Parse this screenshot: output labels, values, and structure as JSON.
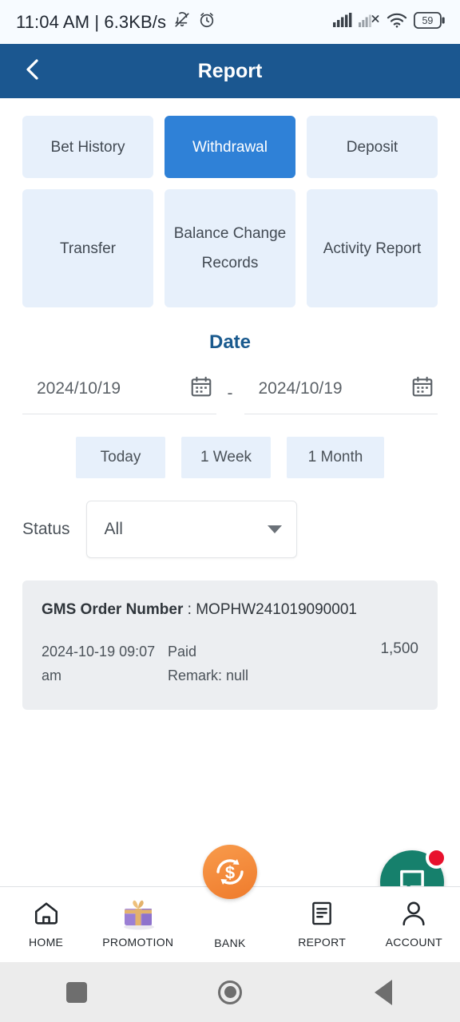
{
  "statusbar": {
    "time_text": "11:04 AM | 6.3KB/s",
    "mute_icon": "bell-muted-icon",
    "alarm_icon": "alarm-clock-icon",
    "signal_icon": "signal-bars-icon",
    "signal_off_icon": "signal-bars-no-service-icon",
    "wifi_icon": "wifi-icon",
    "battery_level": "59"
  },
  "header": {
    "title": "Report",
    "back_icon": "chevron-left-icon"
  },
  "tabs": [
    {
      "label": "Bet History",
      "active": false
    },
    {
      "label": "Withdrawal",
      "active": true
    },
    {
      "label": "Deposit",
      "active": false
    },
    {
      "label": "Transfer",
      "active": false
    },
    {
      "label": "Balance Change Records",
      "active": false
    },
    {
      "label": "Activity Report",
      "active": false
    }
  ],
  "date": {
    "title": "Date",
    "start_value": "2024/10/19",
    "end_value": "2024/10/19",
    "separator": "-",
    "calendar_icon": "calendar-icon",
    "quick_ranges": [
      {
        "label": "Today"
      },
      {
        "label": "1 Week"
      },
      {
        "label": "1 Month"
      }
    ]
  },
  "status_filter": {
    "label": "Status",
    "selected": "All",
    "caret_icon": "chevron-down-icon"
  },
  "records": [
    {
      "order_label": "GMS Order Number",
      "order_separator": " : ",
      "order_number": "MOPHW241019090001",
      "datetime": "2024-10-19 09:07 am",
      "status": "Paid",
      "remark": "Remark: null",
      "amount": "1,500"
    }
  ],
  "chat": {
    "icon": "chat-bubble-icon",
    "badge_icon": "notification-dot-icon"
  },
  "bottom_nav": [
    {
      "label": "HOME",
      "icon": "home-icon"
    },
    {
      "label": "PROMOTION",
      "icon": "gift-box-icon"
    },
    {
      "label": "BANK",
      "icon": "bank-dollar-refresh-icon"
    },
    {
      "label": "REPORT",
      "icon": "document-icon"
    },
    {
      "label": "ACCOUNT",
      "icon": "person-icon"
    }
  ],
  "android_nav": [
    {
      "icon": "recents-square-icon"
    },
    {
      "icon": "home-circle-icon"
    },
    {
      "icon": "back-triangle-icon"
    }
  ],
  "colors": {
    "header_blue": "#1b5790",
    "active_tab_blue": "#2f81d7",
    "tab_bg": "#e7f0fb",
    "chat_green": "#16806c",
    "badge_red": "#e8112d",
    "bank_orange": "#ef7b2c"
  }
}
